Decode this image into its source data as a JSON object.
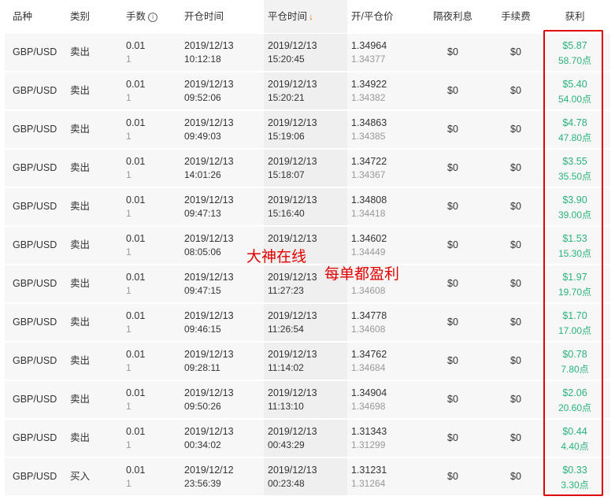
{
  "headers": {
    "symbol": "品种",
    "type": "类别",
    "lots": "手数",
    "open_time": "开仓时间",
    "close_time": "平仓时间",
    "prices": "开/平仓价",
    "swap": "隔夜利息",
    "fee": "手续费",
    "profit": "获利"
  },
  "icons": {
    "sort": "arrow-down-icon",
    "info": "info-icon"
  },
  "colors": {
    "profit": "#2ab27b",
    "sort_arrow": "#ff6a00",
    "highlight_box": "#e00000"
  },
  "overlay": {
    "text1": "大神在线",
    "text2": "每单都盈利"
  },
  "rows": [
    {
      "symbol": "GBP/USD",
      "type": "卖出",
      "lots": "0.01",
      "lots_sub": "1",
      "open_date": "2019/12/13",
      "open_time": "10:12:18",
      "close_date": "2019/12/13",
      "close_time": "15:20:45",
      "open_price": "1.34964",
      "close_price": "1.34377",
      "swap": "$0",
      "fee": "$0",
      "profit": "$5.87",
      "points": "58.70点"
    },
    {
      "symbol": "GBP/USD",
      "type": "卖出",
      "lots": "0.01",
      "lots_sub": "1",
      "open_date": "2019/12/13",
      "open_time": "09:52:06",
      "close_date": "2019/12/13",
      "close_time": "15:20:21",
      "open_price": "1.34922",
      "close_price": "1.34382",
      "swap": "$0",
      "fee": "$0",
      "profit": "$5.40",
      "points": "54.00点"
    },
    {
      "symbol": "GBP/USD",
      "type": "卖出",
      "lots": "0.01",
      "lots_sub": "1",
      "open_date": "2019/12/13",
      "open_time": "09:49:03",
      "close_date": "2019/12/13",
      "close_time": "15:19:06",
      "open_price": "1.34863",
      "close_price": "1.34385",
      "swap": "$0",
      "fee": "$0",
      "profit": "$4.78",
      "points": "47.80点"
    },
    {
      "symbol": "GBP/USD",
      "type": "卖出",
      "lots": "0.01",
      "lots_sub": "1",
      "open_date": "2019/12/13",
      "open_time": "14:01:26",
      "close_date": "2019/12/13",
      "close_time": "15:18:07",
      "open_price": "1.34722",
      "close_price": "1.34367",
      "swap": "$0",
      "fee": "$0",
      "profit": "$3.55",
      "points": "35.50点"
    },
    {
      "symbol": "GBP/USD",
      "type": "卖出",
      "lots": "0.01",
      "lots_sub": "1",
      "open_date": "2019/12/13",
      "open_time": "09:47:13",
      "close_date": "2019/12/13",
      "close_time": "15:16:40",
      "open_price": "1.34808",
      "close_price": "1.34418",
      "swap": "$0",
      "fee": "$0",
      "profit": "$3.90",
      "points": "39.00点"
    },
    {
      "symbol": "GBP/USD",
      "type": "卖出",
      "lots": "0.01",
      "lots_sub": "1",
      "open_date": "2019/12/13",
      "open_time": "08:05:06",
      "close_date": "2019/12/13",
      "close_time": "",
      "open_price": "1.34602",
      "close_price": "1.34449",
      "swap": "$0",
      "fee": "$0",
      "profit": "$1.53",
      "points": "15.30点"
    },
    {
      "symbol": "GBP/USD",
      "type": "卖出",
      "lots": "0.01",
      "lots_sub": "1",
      "open_date": "2019/12/13",
      "open_time": "09:47:15",
      "close_date": "2019/12/13",
      "close_time": "11:27:23",
      "open_price": "",
      "close_price": "1.34608",
      "swap": "$0",
      "fee": "$0",
      "profit": "$1.97",
      "points": "19.70点"
    },
    {
      "symbol": "GBP/USD",
      "type": "卖出",
      "lots": "0.01",
      "lots_sub": "1",
      "open_date": "2019/12/13",
      "open_time": "09:46:15",
      "close_date": "2019/12/13",
      "close_time": "11:26:54",
      "open_price": "1.34778",
      "close_price": "1.34608",
      "swap": "$0",
      "fee": "$0",
      "profit": "$1.70",
      "points": "17.00点"
    },
    {
      "symbol": "GBP/USD",
      "type": "卖出",
      "lots": "0.01",
      "lots_sub": "1",
      "open_date": "2019/12/13",
      "open_time": "09:28:11",
      "close_date": "2019/12/13",
      "close_time": "11:14:02",
      "open_price": "1.34762",
      "close_price": "1.34684",
      "swap": "$0",
      "fee": "$0",
      "profit": "$0.78",
      "points": "7.80点"
    },
    {
      "symbol": "GBP/USD",
      "type": "卖出",
      "lots": "0.01",
      "lots_sub": "1",
      "open_date": "2019/12/13",
      "open_time": "09:50:26",
      "close_date": "2019/12/13",
      "close_time": "11:13:10",
      "open_price": "1.34904",
      "close_price": "1.34698",
      "swap": "$0",
      "fee": "$0",
      "profit": "$2.06",
      "points": "20.60点"
    },
    {
      "symbol": "GBP/USD",
      "type": "卖出",
      "lots": "0.01",
      "lots_sub": "1",
      "open_date": "2019/12/13",
      "open_time": "00:34:02",
      "close_date": "2019/12/13",
      "close_time": "00:43:29",
      "open_price": "1.31343",
      "close_price": "1.31299",
      "swap": "$0",
      "fee": "$0",
      "profit": "$0.44",
      "points": "4.40点"
    },
    {
      "symbol": "GBP/USD",
      "type": "买入",
      "lots": "0.01",
      "lots_sub": "1",
      "open_date": "2019/12/12",
      "open_time": "23:56:39",
      "close_date": "2019/12/13",
      "close_time": "00:23:48",
      "open_price": "1.31231",
      "close_price": "1.31264",
      "swap": "$0",
      "fee": "$0",
      "profit": "$0.33",
      "points": "3.30点"
    }
  ]
}
